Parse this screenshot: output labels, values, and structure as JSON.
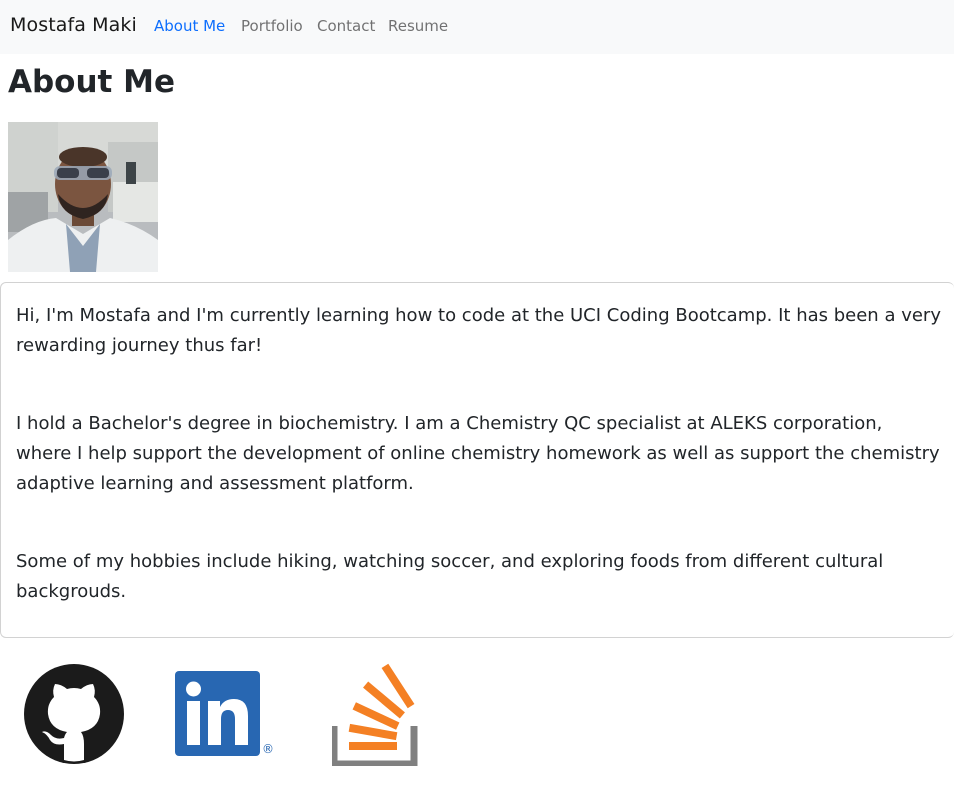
{
  "navbar": {
    "brand": "Mostafa Maki",
    "links": [
      {
        "label": "About Me",
        "active": true
      },
      {
        "label": "Portfolio",
        "active": false
      },
      {
        "label": "Contact",
        "active": false
      },
      {
        "label": "Resume",
        "active": false
      }
    ]
  },
  "page": {
    "title": "About Me"
  },
  "bio": {
    "paragraphs": [
      "Hi, I'm Mostafa and I'm currently learning how to code at the UCI Coding Bootcamp. It has been a very rewarding journey thus far!",
      "I hold a Bachelor's degree in biochemistry. I am a Chemistry QC specialist at ALEKS corporation, where I help support the development of online chemistry homework as well as support the chemistry adaptive learning and assessment platform.",
      "Some of my hobbies include hiking, watching soccer, and exploring foods from different cultural backgrouds."
    ]
  },
  "social": [
    {
      "icon": "github-icon"
    },
    {
      "icon": "linkedin-icon",
      "mark": "®"
    },
    {
      "icon": "stackoverflow-icon"
    }
  ],
  "colors": {
    "nav_bg": "#f8f9fa",
    "active_link": "#0d6efd",
    "linkedin": "#2867b2",
    "stackoverflow_orange": "#f48024",
    "stackoverflow_gray": "#808080"
  }
}
